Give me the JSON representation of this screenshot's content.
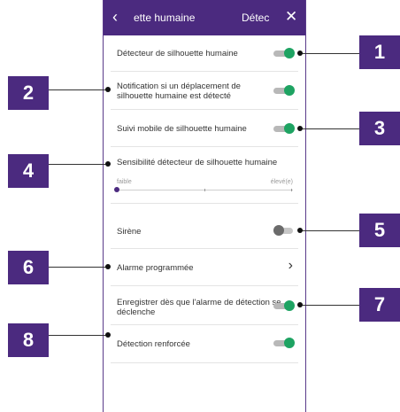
{
  "header": {
    "back_icon": "chevron-left-icon",
    "title_left": "ette humaine",
    "title_right": "Détec",
    "close_icon": "close-icon"
  },
  "settings": {
    "detector": {
      "label": "Détecteur de silhouette humaine",
      "enabled": true
    },
    "notification": {
      "label_line1": "Notification si un déplacement de",
      "label_line2": "silhouette humaine est détecté",
      "enabled": true
    },
    "tracking": {
      "label": "Suivi mobile de silhouette humaine",
      "enabled": true
    },
    "sensitivity": {
      "label": "Sensibilité détecteur de silhouette humaine",
      "min_label": "faible",
      "max_label": "élevé(e)",
      "level": 0.0
    },
    "siren": {
      "label": "Sirène",
      "enabled": false
    },
    "scheduled_alarm": {
      "label": "Alarme programmée",
      "chevron_icon": "chevron-right-icon"
    },
    "record_on_alarm": {
      "label_line1": "Enregistrer dès que l'alarme de détection se",
      "label_line2": "déclenche",
      "enabled": true
    },
    "enhanced_detection": {
      "label": "Détection renforcée",
      "enabled": true
    }
  },
  "callouts": [
    "1",
    "2",
    "3",
    "4",
    "5",
    "6",
    "7",
    "8"
  ],
  "colors": {
    "accent": "#4b2a7f",
    "toggle_on": "#1ea362",
    "toggle_off": "#6b6b6b"
  }
}
